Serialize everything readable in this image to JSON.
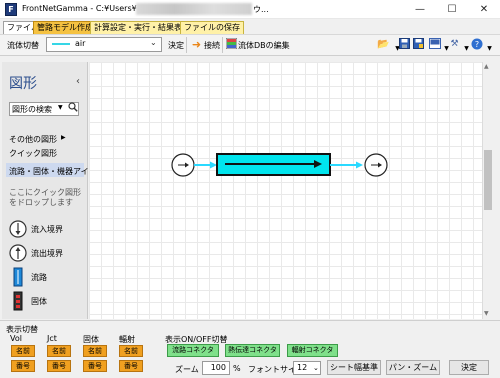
{
  "window": {
    "title": "FrontNetGamma - C:¥Users¥",
    "title_tail": "ウ...",
    "minimize": "—",
    "maximize": "☐",
    "close": "✕"
  },
  "menu": {
    "tabs": [
      "ファイル",
      "管路モデル作成",
      "計算設定・実行・結果表示",
      "ファイルの保存"
    ]
  },
  "toolbar": {
    "fluid_label": "流体切替",
    "fluid_value": "air",
    "confirm": "決定",
    "connect": "接続",
    "fluid_db": "流体DBの編集"
  },
  "shapes_panel": {
    "title": "図形",
    "search_placeholder": "図形の検索",
    "other_shapes": "その他の図形",
    "quick_shapes": "クイック図形",
    "selected_category": "流路・固体・機器アイ...",
    "hint": "ここにクイック図形をドロップします",
    "items": [
      "流入境界",
      "流出境界",
      "流路",
      "固体"
    ]
  },
  "display_toggle": {
    "title": "表示切替",
    "groups": [
      {
        "label": "Vol",
        "name_btn": "名前",
        "num_btn": "番号"
      },
      {
        "label": "Jct",
        "name_btn": "名前",
        "num_btn": "番号"
      },
      {
        "label": "固体",
        "name_btn": "名前",
        "num_btn": "番号"
      },
      {
        "label": "輻射",
        "name_btn": "名前",
        "num_btn": "番号"
      }
    ]
  },
  "onoff_toggle": {
    "title": "表示ON/OFF切替",
    "buttons": [
      "流路コネクタ",
      "熱伝達コネクタ",
      "輻射コネクタ"
    ]
  },
  "zoom": {
    "label": "ズーム",
    "value": "100",
    "unit": "%",
    "font_label": "フォントサイズ",
    "font_value": "12",
    "sheet_width": "シート幅基準",
    "pan_zoom": "パン・ズーム",
    "apply": "決定"
  },
  "colors": {
    "accent_tab": "#f5c242",
    "flow_cyan": "#00e5ee",
    "connector_cyan": "#2ad9ff",
    "green_button": "#7fe08a",
    "orange_button": "#f0a020"
  }
}
